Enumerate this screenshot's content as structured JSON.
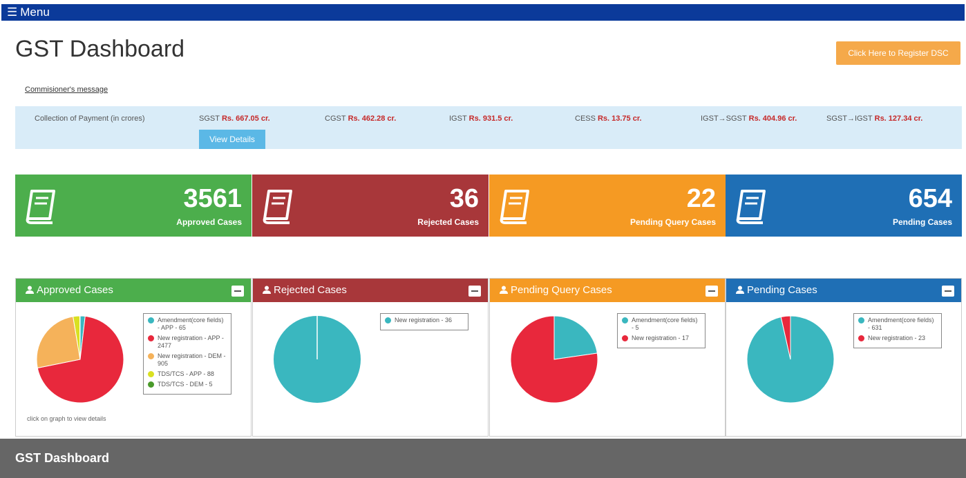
{
  "menu": {
    "label": "Menu"
  },
  "page": {
    "title": "GST Dashboard"
  },
  "dsc_button": "Click Here to Register DSC",
  "commissioner_link": "Commisioner's message",
  "collection": {
    "label": "Collection of Payment (in crores)",
    "items": [
      {
        "name": "SGST",
        "amount": "Rs. 667.05 cr."
      },
      {
        "name": "CGST",
        "amount": "Rs. 462.28 cr."
      },
      {
        "name": "IGST",
        "amount": "Rs. 931.5 cr."
      },
      {
        "name": "CESS",
        "amount": "Rs. 13.75 cr."
      },
      {
        "name": "IGST→SGST",
        "amount": "Rs. 404.96 cr."
      },
      {
        "name": "SGST→IGST",
        "amount": "Rs. 127.34 cr."
      }
    ],
    "view_details": "View Details"
  },
  "stats": [
    {
      "value": "3561",
      "label": "Approved Cases",
      "color": "#4cae4c"
    },
    {
      "value": "36",
      "label": "Rejected Cases",
      "color": "#a8373a"
    },
    {
      "value": "22",
      "label": "Pending Query Cases",
      "color": "#f59a23"
    },
    {
      "value": "654",
      "label": "Pending Cases",
      "color": "#1f6fb5"
    }
  ],
  "panels": [
    {
      "title": "Approved Cases",
      "color": "#4cae4c",
      "hint": "click on graph to view details",
      "legend": [
        {
          "label": "Amendment(core fields) - APP - 65",
          "value": 65,
          "color": "#3ab7bf"
        },
        {
          "label": "New registration - APP - 2477",
          "value": 2477,
          "color": "#e8283c"
        },
        {
          "label": "New registration - DEM - 905",
          "value": 905,
          "color": "#f5b25a"
        },
        {
          "label": "TDS/TCS - APP - 88",
          "value": 88,
          "color": "#d9e021"
        },
        {
          "label": "TDS/TCS - DEM - 5",
          "value": 5,
          "color": "#4a9a2a"
        }
      ]
    },
    {
      "title": "Rejected Cases",
      "color": "#a8373a",
      "hint": "",
      "legend": [
        {
          "label": "New registration - 36",
          "value": 36,
          "color": "#3ab7bf"
        }
      ]
    },
    {
      "title": "Pending Query Cases",
      "color": "#f59a23",
      "hint": "",
      "legend": [
        {
          "label": "Amendment(core fields) - 5",
          "value": 5,
          "color": "#3ab7bf"
        },
        {
          "label": "New registration - 17",
          "value": 17,
          "color": "#e8283c"
        }
      ]
    },
    {
      "title": "Pending Cases",
      "color": "#1f6fb5",
      "hint": "",
      "legend": [
        {
          "label": "Amendment(core fields) - 631",
          "value": 631,
          "color": "#3ab7bf"
        },
        {
          "label": "New registration - 23",
          "value": 23,
          "color": "#e8283c"
        }
      ]
    }
  ],
  "footer": "GST Dashboard"
}
